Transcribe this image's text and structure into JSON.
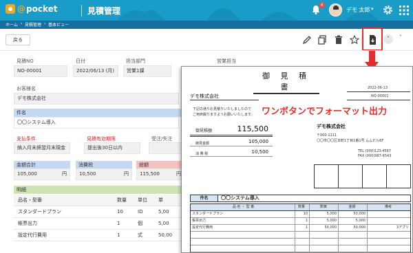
{
  "header": {
    "logo_text": "pocket",
    "logo_at": "@",
    "app_title": "見積管理",
    "notification_count": "4",
    "user_name": "デモ 太郎",
    "brand_color": "#1a9cc9"
  },
  "breadcrumb": [
    "ホーム",
    "見積管理",
    "基本ビュー"
  ],
  "toolbar": {
    "back_label": "戻る",
    "icons": [
      "edit-icon",
      "copy-icon",
      "delete-icon",
      "star-icon",
      "pdf-download-icon",
      "chevron-up-icon",
      "chevron-down-icon"
    ]
  },
  "form": {
    "quote_no_label": "見積NO",
    "quote_no": "NO-00001",
    "date_label": "日付",
    "date": "2022/06/13 (月)",
    "dept_label": "担当部門",
    "dept": "営業1課",
    "sales_rep_label": "営業担当",
    "customer_label": "お客様名",
    "customer": "デモ株式会社",
    "subject_label": "件名",
    "subject": "〇〇システム導入",
    "payment_label": "支払条件",
    "payment": "納入月末締翌月末現金",
    "validity_label": "見積有効期限",
    "validity": "提出後30日以内",
    "order_status_label": "受注/失注",
    "subtotal_label": "金額合計",
    "subtotal": "105,000",
    "tax_label": "消費税",
    "tax": "10,500",
    "total_label": "総額",
    "total": "115,500",
    "yen": "円"
  },
  "details": {
    "section_label": "明細",
    "headers": [
      "品名・型番",
      "数量",
      "単位",
      "単"
    ],
    "rows": [
      [
        "スタンダードプラン",
        "10",
        "ID",
        "5,00"
      ],
      [
        "帳票出力",
        "1",
        "個",
        "5,00"
      ],
      [
        "設定代行費用",
        "1",
        "式",
        "50,00"
      ]
    ]
  },
  "document": {
    "title": "御 見 積 書",
    "date": "2022-06-13",
    "number": "NO-00001",
    "client": "デモ株式会社",
    "intro_1": "下記の通りお見積りいたしましたので",
    "intro_2": "ご用命賜りますようお願いいたします。",
    "callout": "ワンボタンでフォーマット出力",
    "amount_label": "御見積額",
    "amount": "115,500",
    "subtotal_label": "御見金額",
    "subtotal": "105,000",
    "tax_label": "消 費 税",
    "tax": "10,500",
    "company": "デモ株式会社",
    "postal": "〒000-1111",
    "address": "〇〇市〇〇区本町1丁目1番1号 ムムビル6F",
    "tel": "TEL (000)123-4567",
    "fax": "FAX (000)987-6543",
    "subject_label": "件名",
    "subject": "〇〇システム導入",
    "table_headers": [
      "品 名 ・ 型 番",
      "数量",
      "単価",
      "金額",
      "備考"
    ],
    "table_rows": [
      [
        "スタンダードプラン",
        "10",
        "5,000",
        "50,000",
        ""
      ],
      [
        "帳票出力",
        "1",
        "5,000",
        "5,000",
        ""
      ],
      [
        "設定代行費用",
        "1",
        "50,000",
        "50,000",
        "3アプリ"
      ],
      [
        "",
        "",
        "",
        "",
        ""
      ],
      [
        "",
        "",
        "",
        "",
        ""
      ],
      [
        "",
        "",
        "",
        "",
        ""
      ]
    ]
  }
}
